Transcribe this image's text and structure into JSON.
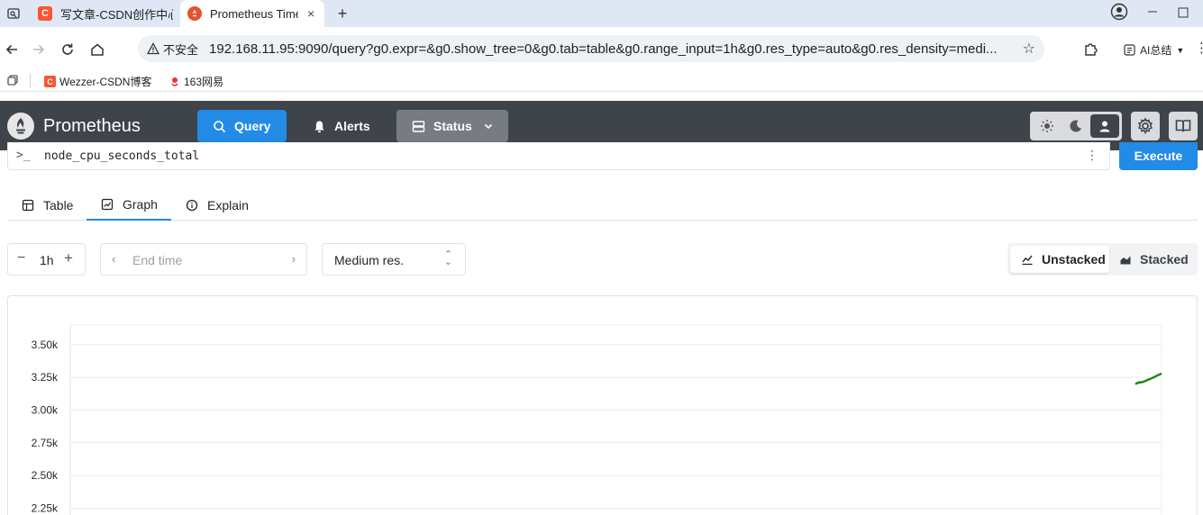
{
  "browser": {
    "tabs": [
      {
        "title": "写文章-CSDN创作中心",
        "favicon": "C"
      },
      {
        "title": "Prometheus Time",
        "close": "×"
      }
    ],
    "new_tab": "+",
    "insecure_label": "不安全",
    "url": "192.168.11.95:9090/query?g0.expr=&g0.show_tree=0&g0.tab=table&g0.range_input=1h&g0.res_type=auto&g0.res_density=medi...",
    "ai_summary": "AI总结",
    "bookmarks": [
      {
        "label": "Wezzer-CSDN博客",
        "favicon": "C"
      },
      {
        "label": "163网易"
      }
    ]
  },
  "navbar": {
    "brand": "Prometheus",
    "query": "Query",
    "alerts": "Alerts",
    "status": "Status"
  },
  "expression": {
    "prompt": ">_",
    "value": "node_cpu_seconds_total",
    "execute": "Execute"
  },
  "tabs": [
    "Table",
    "Graph",
    "Explain"
  ],
  "controls": {
    "range": "1h",
    "end_time_placeholder": "End time",
    "resolution": "Medium res.",
    "unstacked": "Unstacked",
    "stacked": "Stacked"
  },
  "colors": {
    "accent": "#228be6",
    "navbar": "#3f434a",
    "series": "#2ca02c"
  },
  "chart_data": {
    "type": "line",
    "y_tick_labels": [
      "3.50k",
      "3.25k",
      "3.00k",
      "2.75k",
      "2.50k",
      "2.25k"
    ],
    "y_ticks": [
      3500,
      3250,
      3000,
      2750,
      2500,
      2250
    ],
    "ylim": [
      2150,
      3650
    ],
    "grid": true,
    "series": [
      {
        "values": [
          3205,
          3215,
          3218,
          3230,
          3242,
          3255,
          3270,
          3282
        ]
      },
      {
        "values": [
          3198,
          3208,
          3212,
          3224,
          3236,
          3249,
          3264,
          3276
        ]
      }
    ]
  }
}
